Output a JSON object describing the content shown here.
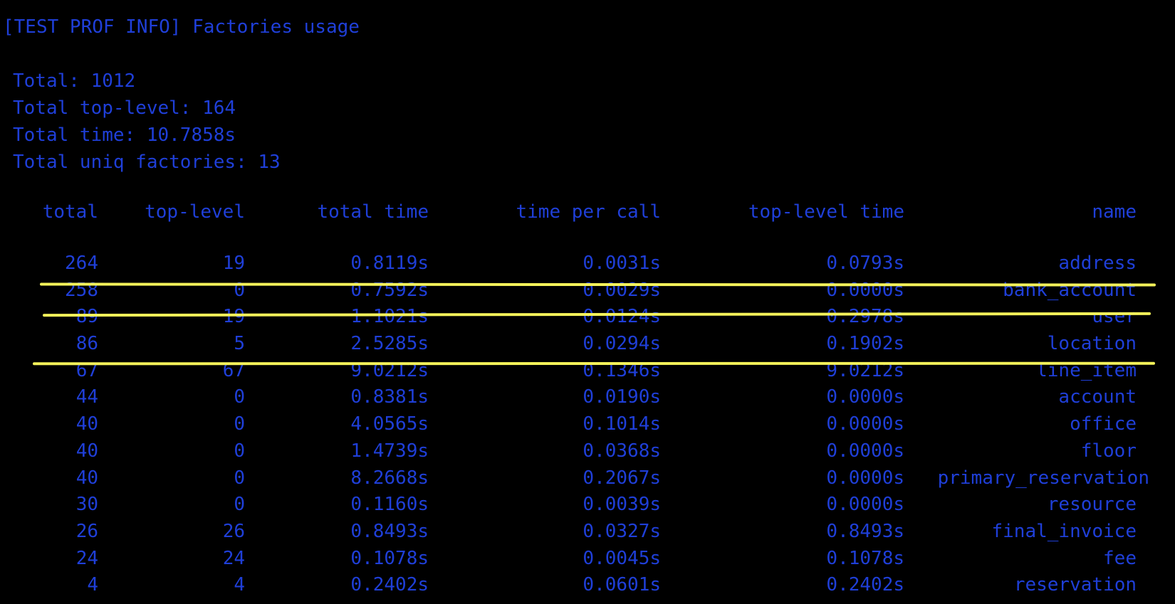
{
  "terminal": {
    "header": "[TEST PROF INFO] Factories usage",
    "stats": [
      "Total: 1012",
      "Total top-level: 164",
      "Total time: 10.7858s",
      "Total uniq factories: 13"
    ],
    "columns": {
      "total": "total",
      "top_level": "top-level",
      "total_time": "total time",
      "time_per_call": "time per call",
      "top_level_time": "top-level time",
      "name": "name"
    },
    "rows": [
      {
        "total": "264",
        "top_level": "19",
        "total_time": "0.8119s",
        "time_per_call": "0.0031s",
        "top_level_time": "0.0793s",
        "name": "address"
      },
      {
        "total": "258",
        "top_level": "0",
        "total_time": "0.7592s",
        "time_per_call": "0.0029s",
        "top_level_time": "0.0000s",
        "name": "bank_account"
      },
      {
        "total": "89",
        "top_level": "19",
        "total_time": "1.1021s",
        "time_per_call": "0.0124s",
        "top_level_time": "0.2978s",
        "name": "user"
      },
      {
        "total": "86",
        "top_level": "5",
        "total_time": "2.5285s",
        "time_per_call": "0.0294s",
        "top_level_time": "0.1902s",
        "name": "location"
      },
      {
        "total": "67",
        "top_level": "67",
        "total_time": "9.0212s",
        "time_per_call": "0.1346s",
        "top_level_time": "9.0212s",
        "name": "line_item"
      },
      {
        "total": "44",
        "top_level": "0",
        "total_time": "0.8381s",
        "time_per_call": "0.0190s",
        "top_level_time": "0.0000s",
        "name": "account"
      },
      {
        "total": "40",
        "top_level": "0",
        "total_time": "4.0565s",
        "time_per_call": "0.1014s",
        "top_level_time": "0.0000s",
        "name": "office"
      },
      {
        "total": "40",
        "top_level": "0",
        "total_time": "1.4739s",
        "time_per_call": "0.0368s",
        "top_level_time": "0.0000s",
        "name": "floor"
      },
      {
        "total": "40",
        "top_level": "0",
        "total_time": "8.2668s",
        "time_per_call": "0.2067s",
        "top_level_time": "0.0000s",
        "name": "primary_reservation"
      },
      {
        "total": "30",
        "top_level": "0",
        "total_time": "0.1160s",
        "time_per_call": "0.0039s",
        "top_level_time": "0.0000s",
        "name": "resource"
      },
      {
        "total": "26",
        "top_level": "26",
        "total_time": "0.8493s",
        "time_per_call": "0.0327s",
        "top_level_time": "0.8493s",
        "name": "final_invoice"
      },
      {
        "total": "24",
        "top_level": "24",
        "total_time": "0.1078s",
        "time_per_call": "0.0045s",
        "top_level_time": "0.1078s",
        "name": "fee"
      },
      {
        "total": "4",
        "top_level": "4",
        "total_time": "0.2402s",
        "time_per_call": "0.0601s",
        "top_level_time": "0.2402s",
        "name": "reservation"
      }
    ]
  },
  "colors": {
    "background": "#000000",
    "text": "#1f3fd8",
    "highlight": "#f4f25a"
  }
}
